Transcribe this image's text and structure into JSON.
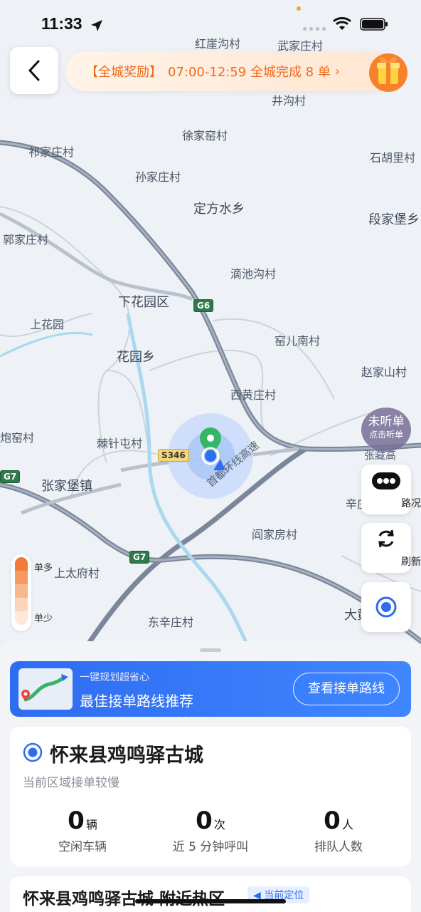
{
  "status_bar": {
    "time": "11:33"
  },
  "top_bar": {
    "reward_tag": "【全城奖励】",
    "reward_text": "07:00-12:59 全城完成 8 单",
    "reward_chevron": "›"
  },
  "map": {
    "places": [
      "红崖沟村",
      "武家庄村",
      "井沟村",
      "徐家窑村",
      "祁家庄村",
      "石胡里村",
      "孙家庄村",
      "定方水乡",
      "段家堡乡",
      "郭家庄村",
      "滴池沟村",
      "下花园区",
      "上花园",
      "窑儿南村",
      "花园乡",
      "赵家山村",
      "西黄庄村",
      "炮窑村",
      "棘针屯村",
      "张家堡镇",
      "辛庄",
      "阎家房村",
      "上太府村",
      "东辛庄村",
      "大黄"
    ],
    "shields": [
      "G6",
      "S346",
      "G7",
      "G7"
    ],
    "road_labels": [
      "首都环线高速",
      "张藏高"
    ]
  },
  "controls": {
    "listen_title": "未听单",
    "listen_sub": "点击听单",
    "traffic_label": "路况",
    "refresh_label": "刷新"
  },
  "heat_legend": {
    "high": "单多",
    "low": "单少",
    "colors": [
      "#f07a3a",
      "#f59a64",
      "#f8b88e",
      "#fbd5bb",
      "#fde8da"
    ]
  },
  "route_card": {
    "subtitle": "一键规划超省心",
    "title": "最佳接单路线推荐",
    "button": "查看接单路线"
  },
  "area_card": {
    "title": "怀来县鸡鸣驿古城",
    "subtitle": "当前区域接单较慢",
    "stats": [
      {
        "value": "0",
        "unit": "辆",
        "caption": "空闲车辆"
      },
      {
        "value": "0",
        "unit": "次",
        "caption": "近 5 分钟呼叫"
      },
      {
        "value": "0",
        "unit": "人",
        "caption": "排队人数"
      }
    ]
  },
  "nearby_card": {
    "title": "怀来县鸡鸣驿古城 附近热区",
    "tag": "◀ 当前定位"
  },
  "colors": {
    "accent": "#2e6cf2",
    "reward": "#f06a1a"
  }
}
